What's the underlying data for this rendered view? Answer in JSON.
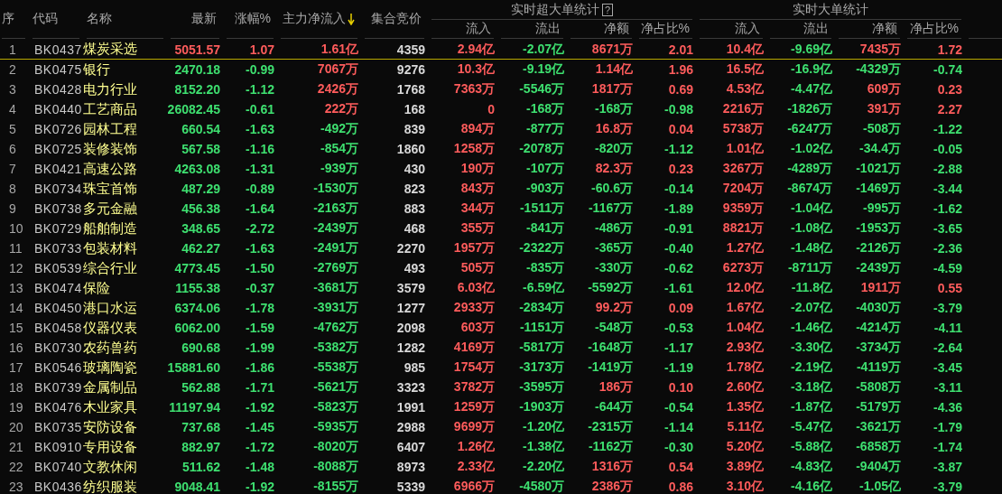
{
  "columns": [
    {
      "label": "序",
      "sorted": false
    },
    {
      "label": "代码",
      "sorted": false
    },
    {
      "label": "名称",
      "sorted": false
    },
    {
      "label": "最新",
      "sorted": false
    },
    {
      "label": "涨幅%",
      "sorted": false
    },
    {
      "label": "主力净流入",
      "sorted": true
    },
    {
      "label": "集合竞价",
      "sorted": false
    }
  ],
  "groups": [
    {
      "title": "实时超大单统计",
      "help": "?",
      "columns": [
        "流入",
        "流出",
        "净额",
        "净占比%"
      ]
    },
    {
      "title": "实时大单统计",
      "columns": [
        "流入",
        "流出",
        "净额",
        "净占比%"
      ]
    }
  ],
  "rows": [
    {
      "index": "1",
      "code": "BK0437",
      "name": "煤炭采选",
      "price": "5051.57",
      "change": "1.07",
      "main_net": "1.61亿",
      "auction": "4359",
      "super": [
        "2.94亿",
        "-2.07亿",
        "8671万",
        "2.01"
      ],
      "large": [
        "10.4亿",
        "-9.69亿",
        "7435万",
        "1.72"
      ],
      "selected": true
    },
    {
      "index": "2",
      "code": "BK0475",
      "name": "银行",
      "price": "2470.18",
      "change": "-0.99",
      "main_net": "7067万",
      "auction": "9276",
      "super": [
        "10.3亿",
        "-9.19亿",
        "1.14亿",
        "1.96"
      ],
      "large": [
        "16.5亿",
        "-16.9亿",
        "-4329万",
        "-0.74"
      ],
      "selected": false
    },
    {
      "index": "3",
      "code": "BK0428",
      "name": "电力行业",
      "price": "8152.20",
      "change": "-1.12",
      "main_net": "2426万",
      "auction": "1768",
      "super": [
        "7363万",
        "-5546万",
        "1817万",
        "0.69"
      ],
      "large": [
        "4.53亿",
        "-4.47亿",
        "609万",
        "0.23"
      ],
      "selected": false
    },
    {
      "index": "4",
      "code": "BK0440",
      "name": "工艺商品",
      "price": "26082.45",
      "change": "-0.61",
      "main_net": "222万",
      "auction": "168",
      "super": [
        "0",
        "-168万",
        "-168万",
        "-0.98"
      ],
      "large": [
        "2216万",
        "-1826万",
        "391万",
        "2.27"
      ],
      "selected": false
    },
    {
      "index": "5",
      "code": "BK0726",
      "name": "园林工程",
      "price": "660.54",
      "change": "-1.63",
      "main_net": "-492万",
      "auction": "839",
      "super": [
        "894万",
        "-877万",
        "16.8万",
        "0.04"
      ],
      "large": [
        "5738万",
        "-6247万",
        "-508万",
        "-1.22"
      ],
      "selected": false
    },
    {
      "index": "6",
      "code": "BK0725",
      "name": "装修装饰",
      "price": "567.58",
      "change": "-1.16",
      "main_net": "-854万",
      "auction": "1860",
      "super": [
        "1258万",
        "-2078万",
        "-820万",
        "-1.12"
      ],
      "large": [
        "1.01亿",
        "-1.02亿",
        "-34.4万",
        "-0.05"
      ],
      "selected": false
    },
    {
      "index": "7",
      "code": "BK0421",
      "name": "高速公路",
      "price": "4263.08",
      "change": "-1.31",
      "main_net": "-939万",
      "auction": "430",
      "super": [
        "190万",
        "-107万",
        "82.3万",
        "0.23"
      ],
      "large": [
        "3267万",
        "-4289万",
        "-1021万",
        "-2.88"
      ],
      "selected": false
    },
    {
      "index": "8",
      "code": "BK0734",
      "name": "珠宝首饰",
      "price": "487.29",
      "change": "-0.89",
      "main_net": "-1530万",
      "auction": "823",
      "super": [
        "843万",
        "-903万",
        "-60.6万",
        "-0.14"
      ],
      "large": [
        "7204万",
        "-8674万",
        "-1469万",
        "-3.44"
      ],
      "selected": false
    },
    {
      "index": "9",
      "code": "BK0738",
      "name": "多元金融",
      "price": "456.38",
      "change": "-1.64",
      "main_net": "-2163万",
      "auction": "883",
      "super": [
        "344万",
        "-1511万",
        "-1167万",
        "-1.89"
      ],
      "large": [
        "9359万",
        "-1.04亿",
        "-995万",
        "-1.62"
      ],
      "selected": false
    },
    {
      "index": "10",
      "code": "BK0729",
      "name": "船舶制造",
      "price": "348.65",
      "change": "-2.72",
      "main_net": "-2439万",
      "auction": "468",
      "super": [
        "355万",
        "-841万",
        "-486万",
        "-0.91"
      ],
      "large": [
        "8821万",
        "-1.08亿",
        "-1953万",
        "-3.65"
      ],
      "selected": false
    },
    {
      "index": "11",
      "code": "BK0733",
      "name": "包装材料",
      "price": "462.27",
      "change": "-1.63",
      "main_net": "-2491万",
      "auction": "2270",
      "super": [
        "1957万",
        "-2322万",
        "-365万",
        "-0.40"
      ],
      "large": [
        "1.27亿",
        "-1.48亿",
        "-2126万",
        "-2.36"
      ],
      "selected": false
    },
    {
      "index": "12",
      "code": "BK0539",
      "name": "综合行业",
      "price": "4773.45",
      "change": "-1.50",
      "main_net": "-2769万",
      "auction": "493",
      "super": [
        "505万",
        "-835万",
        "-330万",
        "-0.62"
      ],
      "large": [
        "6273万",
        "-8711万",
        "-2439万",
        "-4.59"
      ],
      "selected": false
    },
    {
      "index": "13",
      "code": "BK0474",
      "name": "保险",
      "price": "1155.38",
      "change": "-0.37",
      "main_net": "-3681万",
      "auction": "3579",
      "super": [
        "6.03亿",
        "-6.59亿",
        "-5592万",
        "-1.61"
      ],
      "large": [
        "12.0亿",
        "-11.8亿",
        "1911万",
        "0.55"
      ],
      "selected": false
    },
    {
      "index": "14",
      "code": "BK0450",
      "name": "港口水运",
      "price": "6374.06",
      "change": "-1.78",
      "main_net": "-3931万",
      "auction": "1277",
      "super": [
        "2933万",
        "-2834万",
        "99.2万",
        "0.09"
      ],
      "large": [
        "1.67亿",
        "-2.07亿",
        "-4030万",
        "-3.79"
      ],
      "selected": false
    },
    {
      "index": "15",
      "code": "BK0458",
      "name": "仪器仪表",
      "price": "6062.00",
      "change": "-1.59",
      "main_net": "-4762万",
      "auction": "2098",
      "super": [
        "603万",
        "-1151万",
        "-548万",
        "-0.53"
      ],
      "large": [
        "1.04亿",
        "-1.46亿",
        "-4214万",
        "-4.11"
      ],
      "selected": false
    },
    {
      "index": "16",
      "code": "BK0730",
      "name": "农药兽药",
      "price": "690.68",
      "change": "-1.99",
      "main_net": "-5382万",
      "auction": "1282",
      "super": [
        "4169万",
        "-5817万",
        "-1648万",
        "-1.17"
      ],
      "large": [
        "2.93亿",
        "-3.30亿",
        "-3734万",
        "-2.64"
      ],
      "selected": false
    },
    {
      "index": "17",
      "code": "BK0546",
      "name": "玻璃陶瓷",
      "price": "15881.60",
      "change": "-1.86",
      "main_net": "-5538万",
      "auction": "985",
      "super": [
        "1754万",
        "-3173万",
        "-1419万",
        "-1.19"
      ],
      "large": [
        "1.78亿",
        "-2.19亿",
        "-4119万",
        "-3.45"
      ],
      "selected": false
    },
    {
      "index": "18",
      "code": "BK0739",
      "name": "金属制品",
      "price": "562.88",
      "change": "-1.71",
      "main_net": "-5621万",
      "auction": "3323",
      "super": [
        "3782万",
        "-3595万",
        "186万",
        "0.10"
      ],
      "large": [
        "2.60亿",
        "-3.18亿",
        "-5808万",
        "-3.11"
      ],
      "selected": false
    },
    {
      "index": "19",
      "code": "BK0476",
      "name": "木业家具",
      "price": "11197.94",
      "change": "-1.92",
      "main_net": "-5823万",
      "auction": "1991",
      "super": [
        "1259万",
        "-1903万",
        "-644万",
        "-0.54"
      ],
      "large": [
        "1.35亿",
        "-1.87亿",
        "-5179万",
        "-4.36"
      ],
      "selected": false
    },
    {
      "index": "20",
      "code": "BK0735",
      "name": "安防设备",
      "price": "737.68",
      "change": "-1.45",
      "main_net": "-5935万",
      "auction": "2988",
      "super": [
        "9699万",
        "-1.20亿",
        "-2315万",
        "-1.14"
      ],
      "large": [
        "5.11亿",
        "-5.47亿",
        "-3621万",
        "-1.79"
      ],
      "selected": false
    },
    {
      "index": "21",
      "code": "BK0910",
      "name": "专用设备",
      "price": "882.97",
      "change": "-1.72",
      "main_net": "-8020万",
      "auction": "6407",
      "super": [
        "1.26亿",
        "-1.38亿",
        "-1162万",
        "-0.30"
      ],
      "large": [
        "5.20亿",
        "-5.88亿",
        "-6858万",
        "-1.74"
      ],
      "selected": false
    },
    {
      "index": "22",
      "code": "BK0740",
      "name": "文教休闲",
      "price": "511.62",
      "change": "-1.48",
      "main_net": "-8088万",
      "auction": "8973",
      "super": [
        "2.33亿",
        "-2.20亿",
        "1316万",
        "0.54"
      ],
      "large": [
        "3.89亿",
        "-4.83亿",
        "-9404万",
        "-3.87"
      ],
      "selected": false
    },
    {
      "index": "23",
      "code": "BK0436",
      "name": "纺织服装",
      "price": "9048.41",
      "change": "-1.92",
      "main_net": "-8155万",
      "auction": "5339",
      "super": [
        "6966万",
        "-4580万",
        "2386万",
        "0.86"
      ],
      "large": [
        "3.10亿",
        "-4.16亿",
        "-1.05亿",
        "-3.79"
      ],
      "selected": false
    }
  ]
}
